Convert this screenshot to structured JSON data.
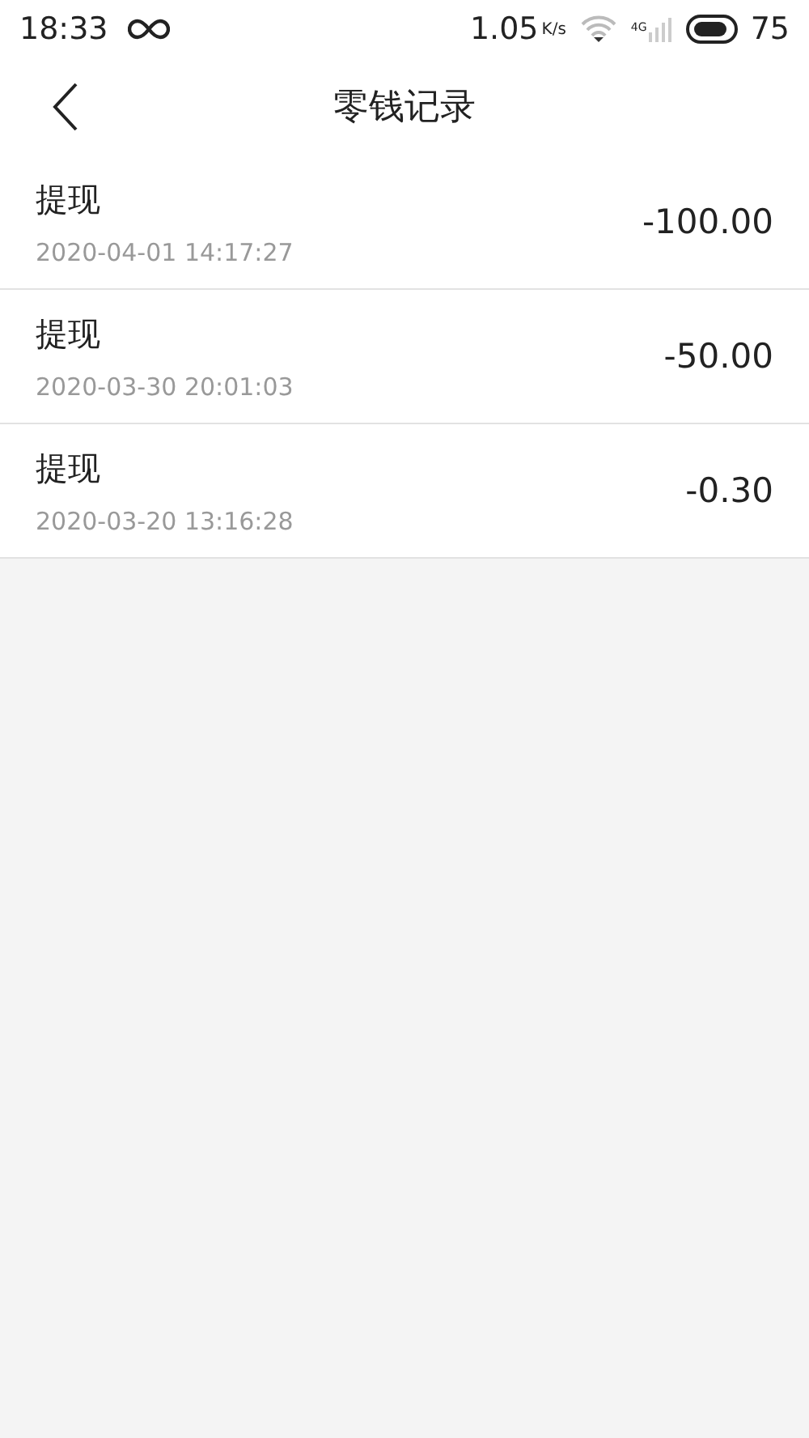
{
  "status_bar": {
    "time": "18:33",
    "speed": "1.05",
    "speed_unit": "K/s",
    "network": "4G",
    "battery": "75"
  },
  "header": {
    "title": "零钱记录"
  },
  "records": [
    {
      "label": "提现",
      "time": "2020-04-01 14:17:27",
      "amount": "-100.00"
    },
    {
      "label": "提现",
      "time": "2020-03-30 20:01:03",
      "amount": "-50.00"
    },
    {
      "label": "提现",
      "time": "2020-03-20 13:16:28",
      "amount": "-0.30"
    }
  ]
}
